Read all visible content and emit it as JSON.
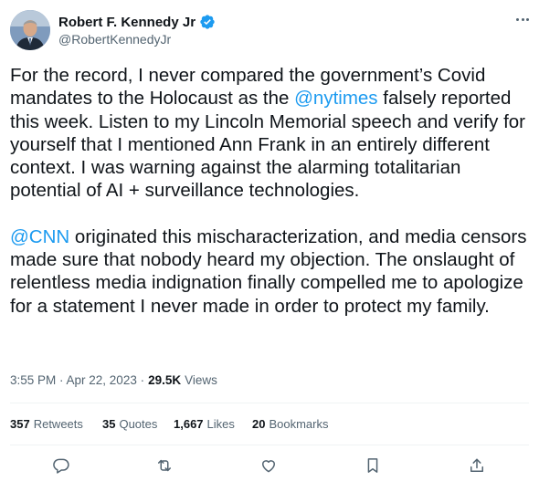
{
  "author": {
    "name": "Robert F. Kennedy Jr",
    "handle": "@RobertKennedyJr",
    "verified": true,
    "accent": "#1d9bf0"
  },
  "tweet": {
    "p1": {
      "t1": "For the record, I never compared the government’s Covid mandates to the Holocaust as the ",
      "mention": "@nytimes",
      "t2": "  falsely reported this week. Listen to my Lincoln Memorial speech and verify for yourself that I mentioned Ann Frank in an entirely different context. I was warning against the alarming totalitarian potential of AI + surveillance technologies."
    },
    "p2": {
      "mention": "@CNN",
      "t1": " originated this mischaracterization, and media censors made sure that nobody heard my objection. The onslaught of relentless media indignation finally compelled me to apologize for a statement I never made in order to protect my family."
    }
  },
  "meta": {
    "time": "3:55 PM · Apr 22, 2023 · ",
    "views_count": "29.5K",
    "views_label": "Views"
  },
  "stats": {
    "retweets_count": "357",
    "retweets_label": "Retweets",
    "quotes_count": "35",
    "quotes_label": "Quotes",
    "likes_count": "1,667",
    "likes_label": "Likes",
    "bookmarks_count": "20",
    "bookmarks_label": "Bookmarks"
  },
  "icons": [
    "reply-icon",
    "retweet-icon",
    "like-icon",
    "bookmark-icon",
    "share-icon",
    "more-options-icon",
    "verified-badge-icon"
  ]
}
